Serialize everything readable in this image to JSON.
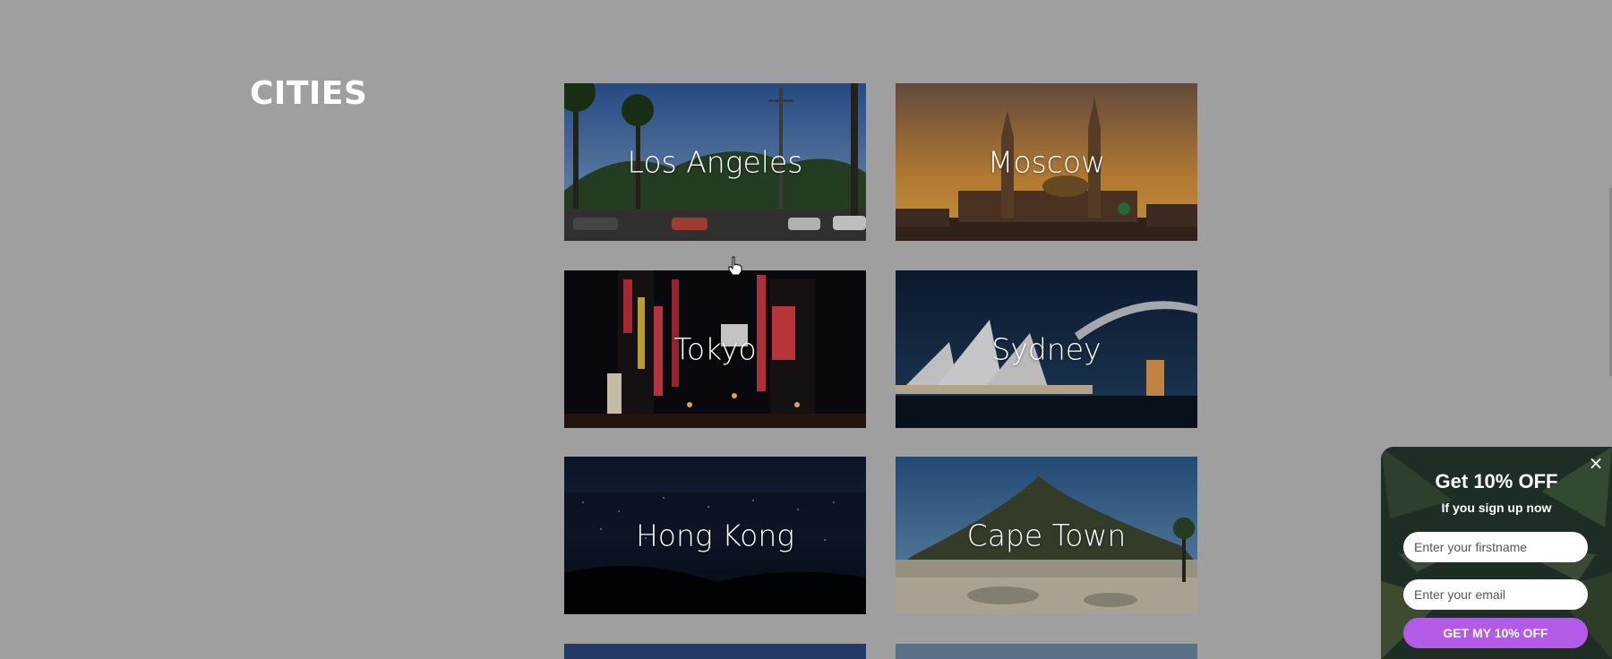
{
  "section": {
    "title": "CITIES"
  },
  "cities": [
    {
      "name": "Los Angeles"
    },
    {
      "name": "Moscow"
    },
    {
      "name": "Tokyo"
    },
    {
      "name": "Sydney"
    },
    {
      "name": "Hong Kong"
    },
    {
      "name": "Cape Town"
    }
  ],
  "promo": {
    "headline": "Get 10% OFF",
    "subtext": "If you sign up now",
    "firstname_placeholder": "Enter your firstname",
    "email_placeholder": "Enter your email",
    "cta_label": "GET MY 10% OFF",
    "close_icon": "×",
    "accent_color": "#b15be6"
  }
}
